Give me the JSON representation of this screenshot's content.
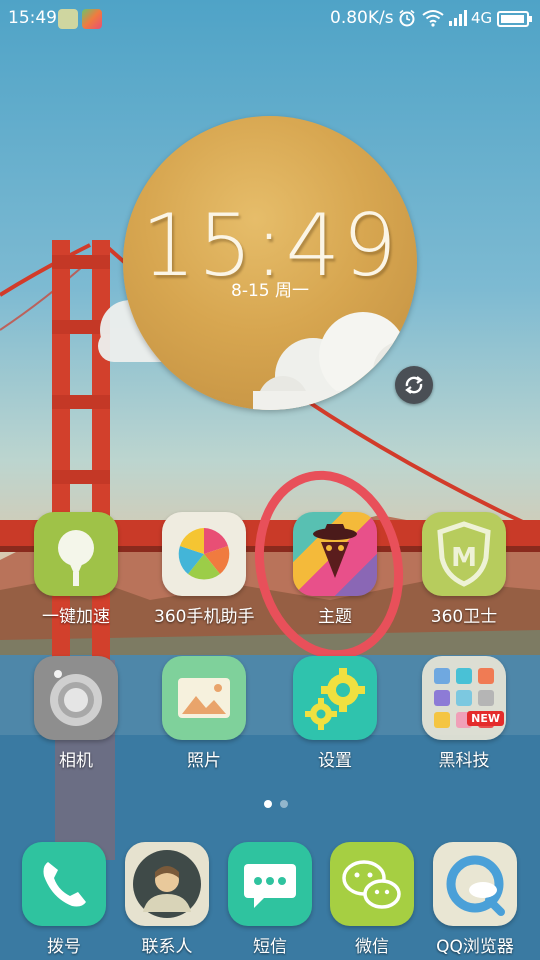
{
  "status_bar": {
    "time": "15:49",
    "speed": "0.80K/s",
    "network": "4G"
  },
  "clock_widget": {
    "time": "15:49",
    "date": "8-15 周一"
  },
  "apps_row1": [
    {
      "label": "一键加速"
    },
    {
      "label": "360手机助手"
    },
    {
      "label": "主题"
    },
    {
      "label": "360卫士"
    }
  ],
  "apps_row2": [
    {
      "label": "相机"
    },
    {
      "label": "照片"
    },
    {
      "label": "设置"
    },
    {
      "label": "黑科技",
      "badge": "NEW"
    }
  ],
  "dock": [
    {
      "label": "拨号"
    },
    {
      "label": "联系人"
    },
    {
      "label": "短信"
    },
    {
      "label": "微信"
    },
    {
      "label": "QQ浏览器"
    }
  ],
  "colors": {
    "highlight_circle": "#e8505a",
    "clock_gold": "#d7a650"
  }
}
